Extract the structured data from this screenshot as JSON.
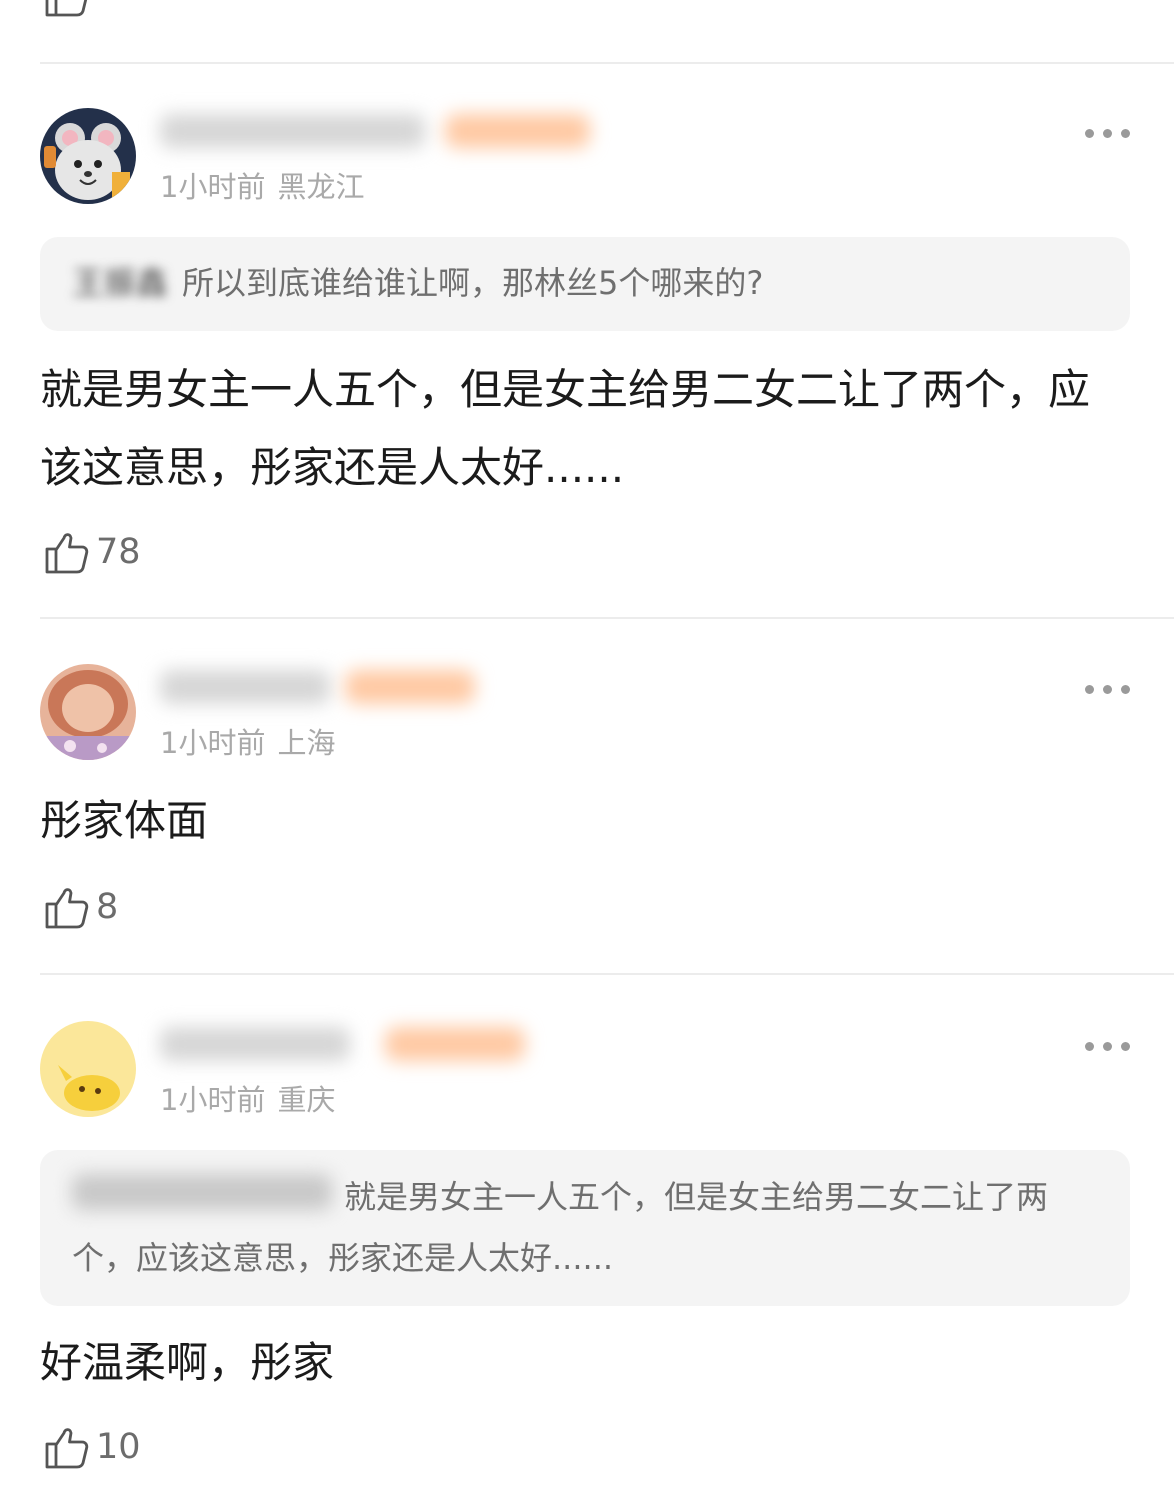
{
  "icons": {
    "like": "thumbs-up-icon",
    "more": "more-dots-icon"
  },
  "colors": {
    "divider": "#ececec",
    "quote_bg": "#f4f4f4",
    "meta_text": "#a9a9a9",
    "badge_blur": "#ffc9a3"
  },
  "comments": [
    {
      "time": "1小时前",
      "location": "黑龙江",
      "quote": {
        "author": "王振鑫",
        "text": "所以到底谁给谁让啊，那林丝5个哪来的?"
      },
      "text": "就是男女主一人五个，但是女主给男二女二让了两个，应该这意思，彤家还是人太好......",
      "likes": "78"
    },
    {
      "time": "1小时前",
      "location": "上海",
      "text": "彤家体面",
      "likes": "8"
    },
    {
      "time": "1小时前",
      "location": "重庆",
      "quote": {
        "author": "",
        "text": "就是男女主一人五个，但是女主给男二女二让了两个，应该这意思，彤家还是人太好......"
      },
      "text": "好温柔啊，彤家",
      "likes": "10"
    }
  ]
}
